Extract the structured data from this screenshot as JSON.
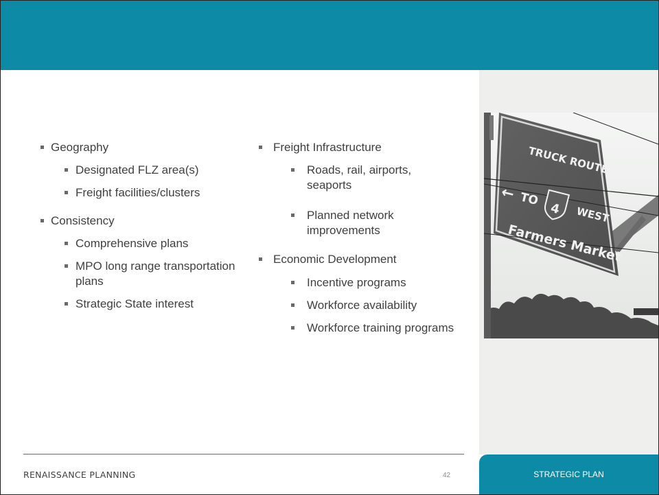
{
  "slide": {
    "left_column": {
      "geography": "Geography",
      "geography_items": [
        "Designated FLZ area(s)",
        "Freight facilities/clusters"
      ],
      "consistency": "Consistency",
      "consistency_items": [
        "Comprehensive plans",
        "MPO long range transportation",
        "plans",
        "Strategic State interest"
      ]
    },
    "right_column": {
      "freight_infrastructure": "Freight Infrastructure",
      "freight_items": [
        "Roads, rail, airports,",
        "seaports",
        "Planned network",
        "improvements"
      ],
      "economic_development": "Economic Development",
      "economic_items": [
        "Incentive programs",
        "Workforce availability",
        "Workforce training programs"
      ]
    },
    "photo": {
      "sign_line_1": "TRUCK ROUTE",
      "sign_to": "TO",
      "sign_route_number": "4",
      "sign_west": "WEST",
      "sign_line_3": "Farmers Market"
    }
  },
  "footer": {
    "organization": "RENAISSANCE PLANNING",
    "page_number": "42",
    "section_label": "STRATEGIC PLAN"
  },
  "theme": {
    "accent": "#0c8aa6",
    "panel": "#efefed",
    "text": "#404040"
  }
}
